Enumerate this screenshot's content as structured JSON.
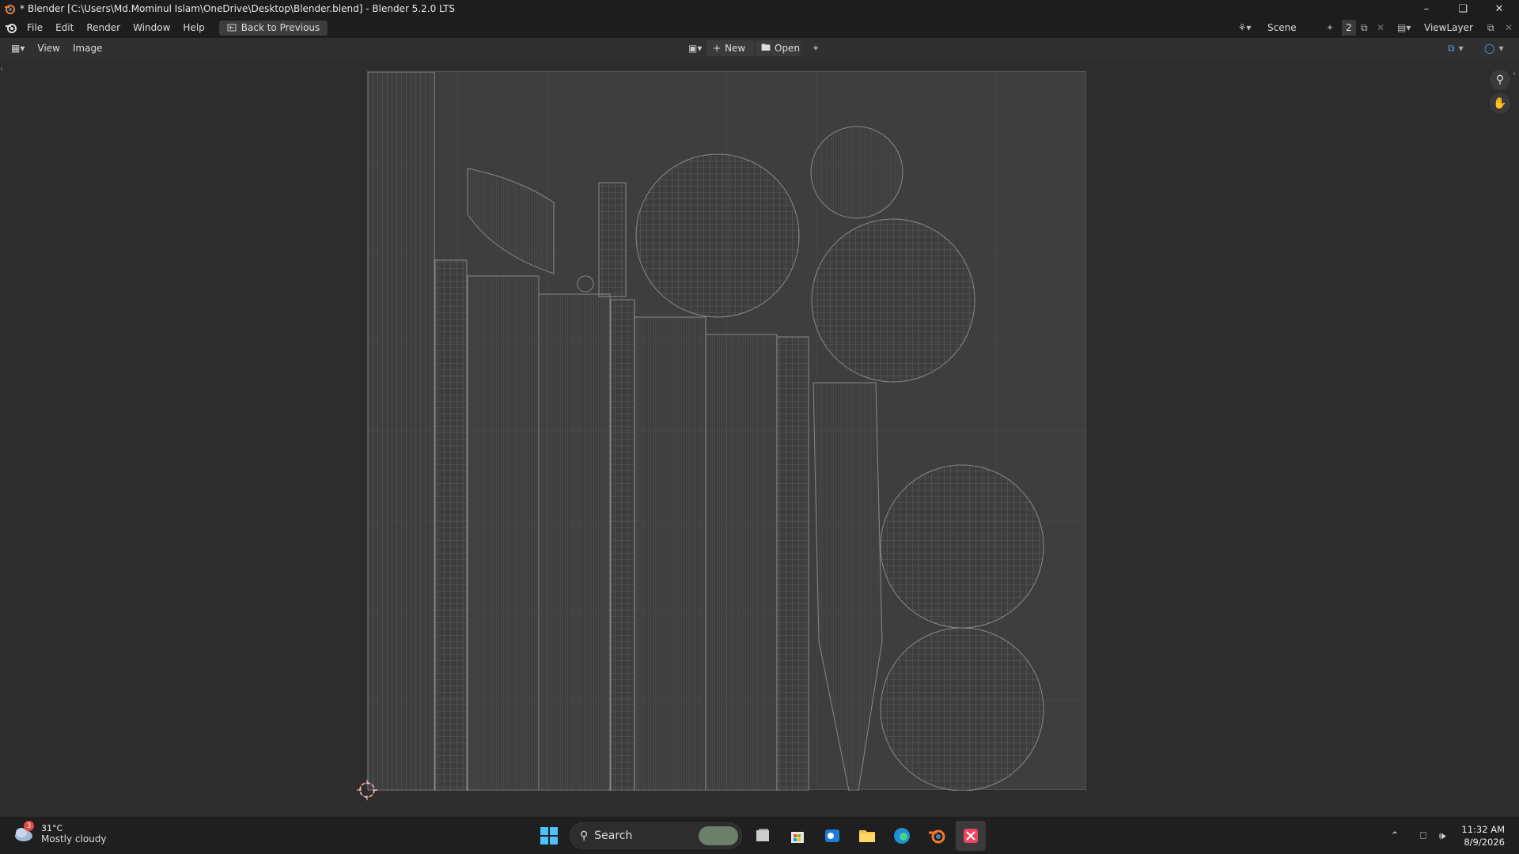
{
  "window": {
    "title": "* Blender [C:\\Users\\Md.Mominul Islam\\OneDrive\\Desktop\\Blender.blend] - Blender 5.2.0 LTS",
    "controls": [
      "minimize-icon",
      "restore-icon",
      "close-icon"
    ]
  },
  "menubar": {
    "items": [
      "File",
      "Edit",
      "Render",
      "Window",
      "Help"
    ],
    "back_button": "Back to Previous",
    "scene_label": "Scene",
    "scene_users": "2",
    "view_layer_label": "ViewLayer"
  },
  "editor_header": {
    "menus": [
      "View",
      "Image"
    ],
    "new_label": "New",
    "open_label": "Open"
  },
  "taskbar": {
    "weather_temp": "31°C",
    "weather_condition": "Mostly cloudy",
    "weather_badge": "3",
    "search_placeholder": "Search",
    "time": "11:32 AM",
    "date": "8/9/2026"
  },
  "colors": {
    "titlebar_bg": "#1d1d1d",
    "viewport_bg": "#2d2d2d",
    "uv_frame_bg": "#3e3e3e",
    "uv_wire": "#8a8a8a"
  }
}
